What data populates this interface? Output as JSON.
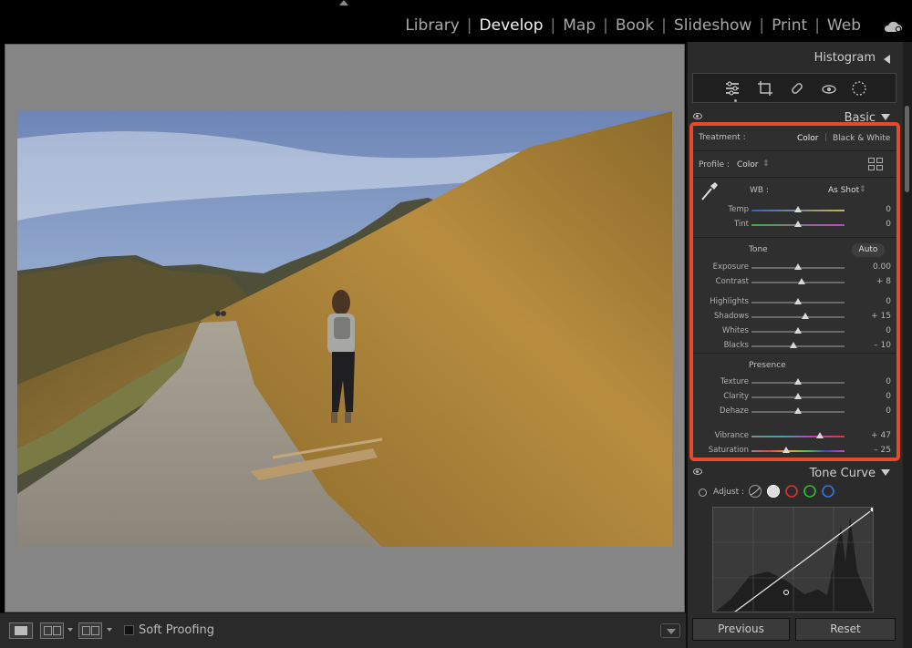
{
  "modules": [
    "Library",
    "Develop",
    "Map",
    "Book",
    "Slideshow",
    "Print",
    "Web"
  ],
  "active_module": "Develop",
  "right_panel": {
    "histogram_title": "Histogram",
    "basic_title": "Basic",
    "treatment_label": "Treatment :",
    "treatment_color": "Color",
    "treatment_bw": "Black & White",
    "profile_label": "Profile :",
    "profile_value": "Color",
    "wb_label": "WB :",
    "wb_value": "As Shot",
    "tone_label": "Tone",
    "auto_label": "Auto",
    "presence_label": "Presence",
    "sliders": [
      {
        "label": "Temp",
        "value": "0",
        "pos": 0.5
      },
      {
        "label": "Tint",
        "value": "0",
        "pos": 0.5
      },
      {
        "label": "Exposure",
        "value": "0.00",
        "pos": 0.5
      },
      {
        "label": "Contrast",
        "value": "+ 8",
        "pos": 0.54
      },
      {
        "label": "Highlights",
        "value": "0",
        "pos": 0.5
      },
      {
        "label": "Shadows",
        "value": "+ 15",
        "pos": 0.575
      },
      {
        "label": "Whites",
        "value": "0",
        "pos": 0.5
      },
      {
        "label": "Blacks",
        "value": "– 10",
        "pos": 0.45
      },
      {
        "label": "Texture",
        "value": "0",
        "pos": 0.5
      },
      {
        "label": "Clarity",
        "value": "0",
        "pos": 0.5
      },
      {
        "label": "Dehaze",
        "value": "0",
        "pos": 0.5
      },
      {
        "label": "Vibrance",
        "value": "+ 47",
        "pos": 0.735
      },
      {
        "label": "Saturation",
        "value": "– 25",
        "pos": 0.375
      }
    ],
    "tone_curve_title": "Tone Curve",
    "adjust_label": "Adjust :",
    "previous_label": "Previous",
    "reset_label": "Reset"
  },
  "toolbar": {
    "soft_proofing_label": "Soft Proofing"
  },
  "colors": {
    "highlight_border": "#e8492b",
    "panel_bg": "#2b2b2b",
    "canvas_bg": "#858585"
  }
}
